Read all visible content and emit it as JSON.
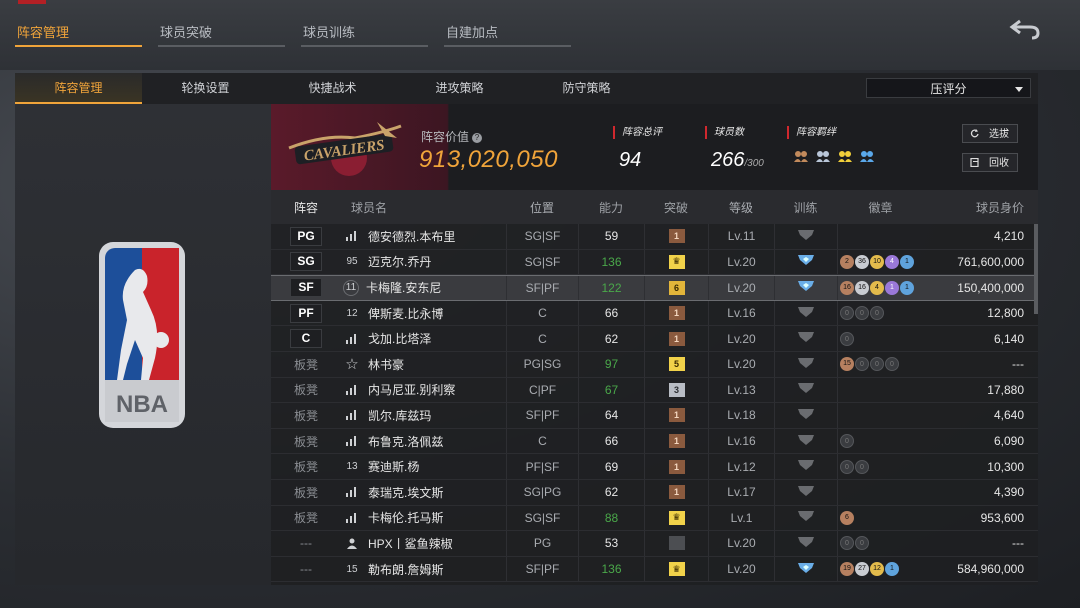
{
  "top_tabs": [
    {
      "label": "阵容管理",
      "active": true
    },
    {
      "label": "球员突破",
      "active": false
    },
    {
      "label": "球员训练",
      "active": false
    },
    {
      "label": "自建加点",
      "active": false
    }
  ],
  "sub_tabs": [
    {
      "label": "阵容管理",
      "active": true
    },
    {
      "label": "轮换设置",
      "active": false
    },
    {
      "label": "快捷战术",
      "active": false
    },
    {
      "label": "进攻策略",
      "active": false
    },
    {
      "label": "防守策略",
      "active": false
    }
  ],
  "sort_select": {
    "value": "压评分"
  },
  "team": {
    "value_label": "阵容价值",
    "value": "913,020,050",
    "overall_label": "阵容总评",
    "overall": "94",
    "players_label": "球员数",
    "players": "266",
    "players_max": "/300",
    "bond_label": "阵容羁绊",
    "select_btn": "选拔",
    "recycle_btn": "回收"
  },
  "columns": {
    "pos": "阵容",
    "name": "球员名",
    "loc": "位置",
    "ability": "能力",
    "breakthrough": "突破",
    "level": "等级",
    "training": "训练",
    "badges": "徽章",
    "price": "球员身价"
  },
  "rows": [
    {
      "pos": "PG",
      "starter": true,
      "icon": "bars",
      "num": "",
      "name": "德安德烈.本布里",
      "loc": "SG|SF",
      "ability": "59",
      "green": false,
      "brk": "1",
      "brk_type": "bronze",
      "level": "Lv.11",
      "train": "gray",
      "badges": [],
      "price": "4,210"
    },
    {
      "pos": "SG",
      "starter": true,
      "icon": "num",
      "num": "95",
      "name": "迈克尔.乔丹",
      "loc": "SG|SF",
      "ability": "136",
      "green": true,
      "brk": "♛",
      "brk_type": "crown",
      "level": "Lv.20",
      "train": "blue",
      "badges": [
        {
          "v": "2",
          "t": "bronze"
        },
        {
          "v": "36",
          "t": "silver"
        },
        {
          "v": "10",
          "t": "gold"
        },
        {
          "v": "4",
          "t": "purple"
        },
        {
          "v": "1",
          "t": "blue"
        }
      ],
      "price": "761,600,000"
    },
    {
      "pos": "SF",
      "starter": true,
      "icon": "ring",
      "num": "11",
      "name": "卡梅隆.安东尼",
      "loc": "SF|PF",
      "ability": "122",
      "green": true,
      "brk": "6",
      "brk_type": "gold",
      "level": "Lv.20",
      "train": "blue",
      "badges": [
        {
          "v": "16",
          "t": "bronze"
        },
        {
          "v": "16",
          "t": "silver"
        },
        {
          "v": "4",
          "t": "gold"
        },
        {
          "v": "1",
          "t": "purple"
        },
        {
          "v": "1",
          "t": "blue"
        }
      ],
      "price": "150,400,000",
      "selected": true
    },
    {
      "pos": "PF",
      "starter": true,
      "icon": "num",
      "num": "12",
      "name": "俾斯麦.比永博",
      "loc": "C",
      "ability": "66",
      "green": false,
      "brk": "1",
      "brk_type": "bronze",
      "level": "Lv.16",
      "train": "gray",
      "badges": [
        {
          "v": "0",
          "t": "empty"
        },
        {
          "v": "0",
          "t": "empty"
        },
        {
          "v": "0",
          "t": "empty"
        }
      ],
      "price": "12,800"
    },
    {
      "pos": "C",
      "starter": true,
      "icon": "bars",
      "num": "",
      "name": "戈加.比塔泽",
      "loc": "C",
      "ability": "62",
      "green": false,
      "brk": "1",
      "brk_type": "bronze",
      "level": "Lv.20",
      "train": "gray",
      "badges": [
        {
          "v": "0",
          "t": "empty"
        }
      ],
      "price": "6,140"
    },
    {
      "pos": "板凳",
      "starter": false,
      "icon": "star",
      "num": "",
      "name": "林书豪",
      "loc": "PG|SG",
      "ability": "97",
      "green": true,
      "brk": "5",
      "brk_type": "yellow",
      "level": "Lv.20",
      "train": "gray",
      "badges": [
        {
          "v": "15",
          "t": "bronze"
        },
        {
          "v": "0",
          "t": "empty"
        },
        {
          "v": "0",
          "t": "empty"
        },
        {
          "v": "0",
          "t": "empty"
        }
      ],
      "price": "---"
    },
    {
      "pos": "板凳",
      "starter": false,
      "icon": "bars",
      "num": "",
      "name": "内马尼亚.别利察",
      "loc": "C|PF",
      "ability": "67",
      "green": true,
      "brk": "3",
      "brk_type": "silver",
      "level": "Lv.13",
      "train": "gray",
      "badges": [],
      "price": "17,880"
    },
    {
      "pos": "板凳",
      "starter": false,
      "icon": "bars",
      "num": "",
      "name": "凯尔.库兹玛",
      "loc": "SF|PF",
      "ability": "64",
      "green": false,
      "brk": "1",
      "brk_type": "bronze",
      "level": "Lv.18",
      "train": "gray",
      "badges": [],
      "price": "4,640"
    },
    {
      "pos": "板凳",
      "starter": false,
      "icon": "bars",
      "num": "",
      "name": "布鲁克.洛佩兹",
      "loc": "C",
      "ability": "66",
      "green": false,
      "brk": "1",
      "brk_type": "bronze",
      "level": "Lv.16",
      "train": "gray",
      "badges": [
        {
          "v": "0",
          "t": "empty"
        }
      ],
      "price": "6,090"
    },
    {
      "pos": "板凳",
      "starter": false,
      "icon": "num",
      "num": "13",
      "name": "赛迪斯.杨",
      "loc": "PF|SF",
      "ability": "69",
      "green": false,
      "brk": "1",
      "brk_type": "bronze",
      "level": "Lv.12",
      "train": "gray",
      "badges": [
        {
          "v": "0",
          "t": "empty"
        },
        {
          "v": "0",
          "t": "empty"
        }
      ],
      "price": "10,300"
    },
    {
      "pos": "板凳",
      "starter": false,
      "icon": "bars",
      "num": "",
      "name": "泰瑞克.埃文斯",
      "loc": "SG|PG",
      "ability": "62",
      "green": false,
      "brk": "1",
      "brk_type": "bronze",
      "level": "Lv.17",
      "train": "gray",
      "badges": [],
      "price": "4,390"
    },
    {
      "pos": "板凳",
      "starter": false,
      "icon": "bars",
      "num": "",
      "name": "卡梅伦.托马斯",
      "loc": "SG|SF",
      "ability": "88",
      "green": true,
      "brk": "♛",
      "brk_type": "crown",
      "level": "Lv.1",
      "train": "gray",
      "badges": [
        {
          "v": "6",
          "t": "bronze"
        }
      ],
      "price": "953,600"
    },
    {
      "pos": "---",
      "starter": false,
      "icon": "person",
      "num": "",
      "name": "HPX丨鲨鱼辣椒",
      "loc": "PG",
      "ability": "53",
      "green": false,
      "brk": "",
      "brk_type": "gray",
      "level": "Lv.20",
      "train": "gray",
      "badges": [
        {
          "v": "0",
          "t": "empty"
        },
        {
          "v": "0",
          "t": "empty"
        }
      ],
      "price": "---"
    },
    {
      "pos": "---",
      "starter": false,
      "icon": "num",
      "num": "15",
      "name": "勒布朗.詹姆斯",
      "loc": "SF|PF",
      "ability": "136",
      "green": true,
      "brk": "♛",
      "brk_type": "crown",
      "level": "Lv.20",
      "train": "blue",
      "badges": [
        {
          "v": "19",
          "t": "bronze"
        },
        {
          "v": "27",
          "t": "silver"
        },
        {
          "v": "12",
          "t": "gold"
        },
        {
          "v": "1",
          "t": "blue"
        }
      ],
      "price": "584,960,000"
    }
  ]
}
